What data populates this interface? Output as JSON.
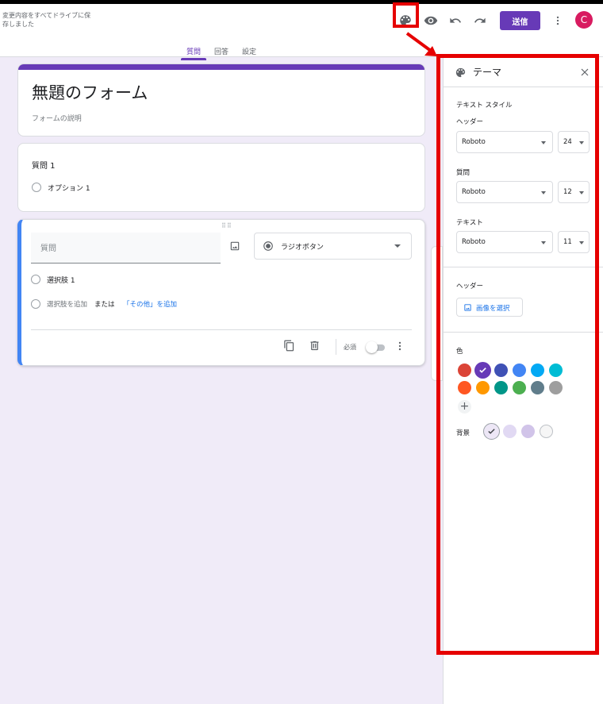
{
  "header": {
    "save_status": "変更内容をすべてドライブに保存しました",
    "send_label": "送信",
    "avatar_initial": "C"
  },
  "tabs": [
    {
      "label": "質問",
      "active": true
    },
    {
      "label": "回答",
      "active": false
    },
    {
      "label": "設定",
      "active": false
    }
  ],
  "form": {
    "title": "無題のフォーム",
    "description": "フォームの説明"
  },
  "question1": {
    "title": "質問 1",
    "option": "オプション 1"
  },
  "question2": {
    "placeholder": "質問",
    "type": "ラジオボタン",
    "option": "選択肢 1",
    "add_option": "選択肢を追加",
    "or_text": "または",
    "add_other": "「その他」を追加",
    "required_label": "必須",
    "required": false
  },
  "theme_panel": {
    "title": "テーマ",
    "text_style_label": "テキスト スタイル",
    "header_label": "ヘッダー",
    "header_font": "Roboto",
    "header_size": "24",
    "question_label": "質問",
    "question_font": "Roboto",
    "question_size": "12",
    "text_label": "テキスト",
    "text_font": "Roboto",
    "text_size": "11",
    "header_image_label": "ヘッダー",
    "choose_image": "画像を選択",
    "color_label": "色",
    "background_label": "背景",
    "colors": [
      "#db4437",
      "#673ab7",
      "#3f51b5",
      "#4285f4",
      "#03a9f4",
      "#00bcd4",
      "#ff5722",
      "#ff9800",
      "#009688",
      "#4caf50",
      "#607d8b",
      "#9e9e9e"
    ],
    "selected_color": "#673ab7",
    "backgrounds": [
      "#ede7f6",
      "#e1d9f3",
      "#d1c4e9",
      "#f6f6f6"
    ],
    "selected_background": "#ede7f6"
  }
}
